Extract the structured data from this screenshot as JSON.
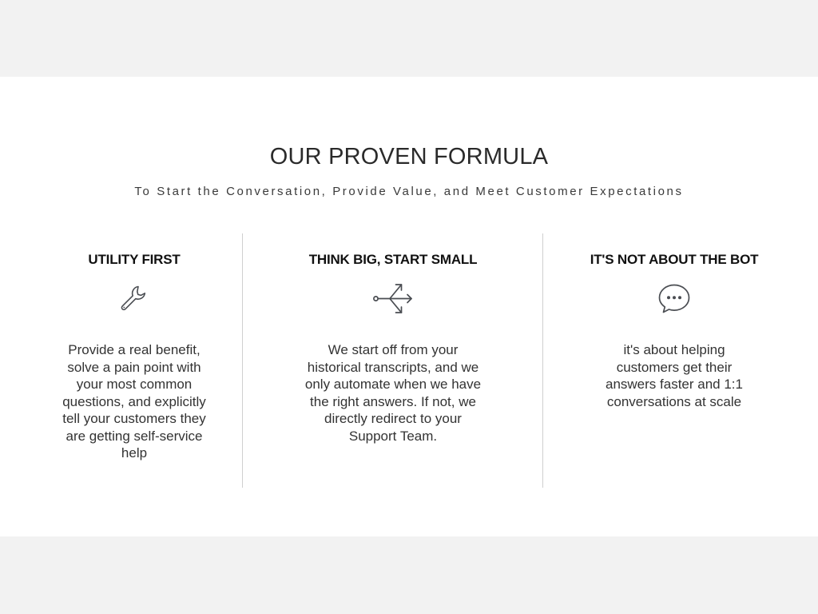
{
  "section": {
    "title": "OUR PROVEN FORMULA",
    "subtitle": "To Start the Conversation, Provide Value, and Meet Customer Expectations"
  },
  "features": [
    {
      "heading": "UTILITY FIRST",
      "icon": "wrench-icon",
      "text": "Provide a real benefit, solve a pain point with your most common questions, and explicitly tell your customers they are getting self-service help"
    },
    {
      "heading": "THINK BIG, START SMALL",
      "icon": "branch-arrows-icon",
      "text": "We start off from your historical transcripts, and we only automate when we have the right answers. If not, we directly redirect to your Support Team."
    },
    {
      "heading": "IT'S NOT ABOUT THE BOT",
      "icon": "chat-bubble-icon",
      "text": "it's about helping customers get their answers faster and 1:1 conversations at scale"
    }
  ],
  "colors": {
    "page_background": "#f2f2f2",
    "section_background": "#ffffff",
    "divider": "#cfcfcf",
    "icon_stroke": "#4a4d52"
  }
}
